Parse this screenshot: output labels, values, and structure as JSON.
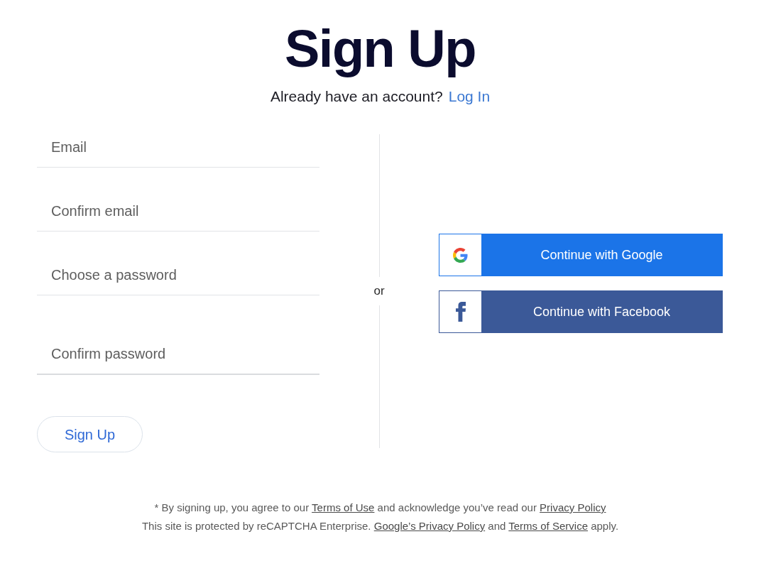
{
  "heading": {
    "title": "Sign Up",
    "prompt": "Already have an account?",
    "login_link": "Log In"
  },
  "form": {
    "fields": [
      {
        "placeholder": "Email"
      },
      {
        "placeholder": "Confirm email"
      },
      {
        "placeholder": "Choose a password"
      },
      {
        "placeholder": "Confirm password"
      }
    ],
    "submit": "Sign Up"
  },
  "divider": {
    "label": "or"
  },
  "social_buttons": [
    {
      "kind": "google",
      "label": "Continue with Google"
    },
    {
      "kind": "facebook",
      "label": "Continue with Facebook"
    }
  ],
  "footer": {
    "lines": [
      [
        {
          "kind": "text",
          "text": "* By signing up, you agree to our"
        },
        {
          "kind": "link",
          "text": "Terms of Use"
        },
        {
          "kind": "text",
          "text": "and acknowledge you’ve read our"
        },
        {
          "kind": "link",
          "text": "Privacy Policy"
        }
      ],
      [
        {
          "kind": "text",
          "text": "This site is protected by reCAPTCHA Enterprise."
        },
        {
          "kind": "link",
          "text": "Google’s Privacy Policy"
        },
        {
          "kind": "text",
          "text": "and"
        },
        {
          "kind": "link",
          "text": "Terms of Service"
        },
        {
          "kind": "text",
          "text": "apply."
        }
      ]
    ]
  }
}
